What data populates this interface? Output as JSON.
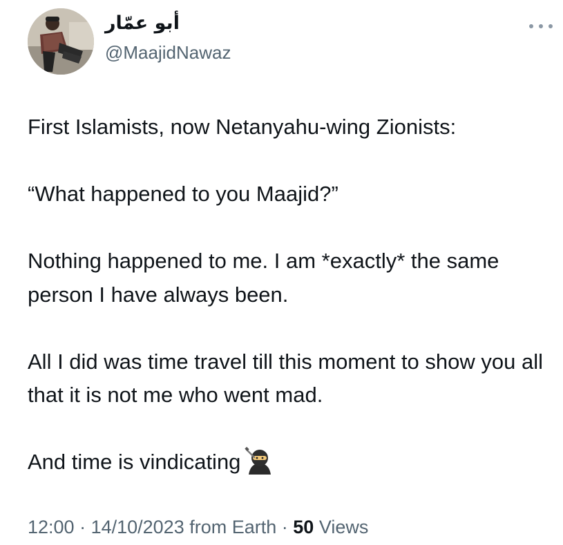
{
  "tweet": {
    "author": {
      "display_name": "أبو عمّار",
      "handle": "@MaajidNawaz"
    },
    "more_menu_icon": "more-horizontal-icon",
    "text_paragraphs": [
      "First Islamists, now Netanyahu-wing Zionists:",
      "“What happened to you Maajid?”",
      "Nothing happened to me. I am *exactly* the same person I have always been.",
      "All I did was time travel till this moment to show you all that it is not me who went mad."
    ],
    "last_line": "And time is vindicating",
    "emoji": "ninja-emoji",
    "meta": {
      "time": "12:00",
      "separator": " · ",
      "date": "14/10/2023",
      "source": "from Earth",
      "views_count": "50",
      "views_label": "Views"
    }
  },
  "colors": {
    "text": "#0f1419",
    "secondary": "#536471",
    "background": "#ffffff"
  }
}
